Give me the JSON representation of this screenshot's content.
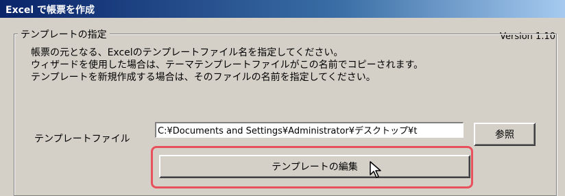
{
  "titlebar": {
    "title": "Excel で帳票を作成"
  },
  "version": "Version 1.10",
  "template_group": {
    "legend": "テンプレートの指定",
    "description": [
      "帳票の元となる、Excelのテンプレートファイル名を指定してください。",
      "ウィザードを使用した場合は、テーマテンプレートファイルがこの名前でコピーされます。",
      "テンプレートを新規作成する場合は、そのファイルの名前を指定してください。"
    ],
    "file_label": "テンプレートファイル",
    "file_value": "C:¥Documents and Settings¥Administrator¥デスクトップ¥t",
    "browse_button": "参照",
    "edit_button": "テンプレートの編集"
  },
  "colors": {
    "titlebar_start": "#0a246a",
    "titlebar_end": "#a6caf0",
    "highlight": "#e8505c",
    "window_bg": "#d4d0c8"
  },
  "icons": [
    "mouse-pointer-icon"
  ]
}
